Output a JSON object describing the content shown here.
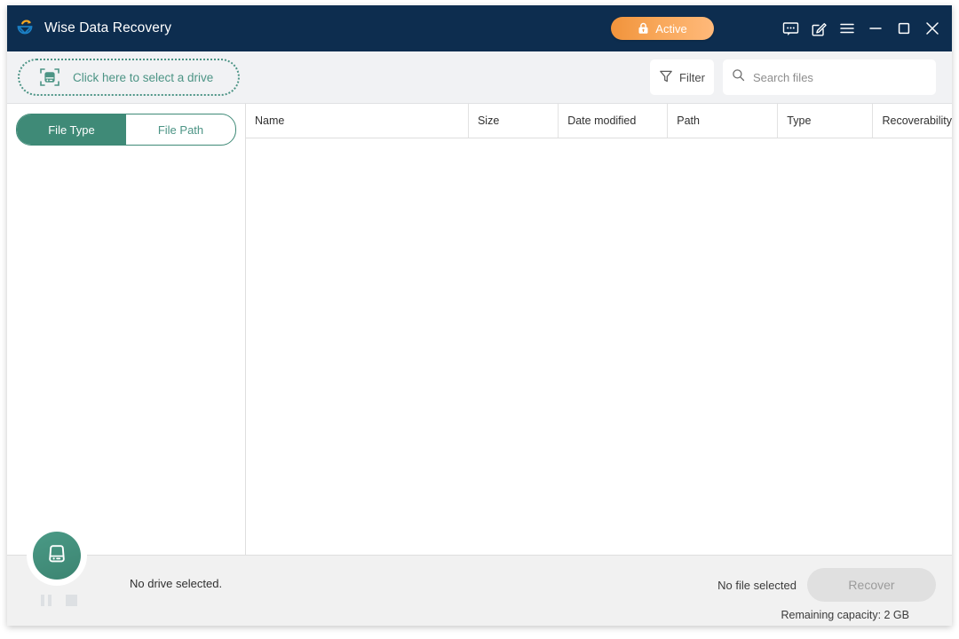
{
  "window": {
    "title": "Wise Data Recovery",
    "logo_icon": "wise-recovery-logo",
    "license_badge": {
      "label": "Active",
      "icon": "lock-icon",
      "color_start": "#f1933b",
      "color_end": "#ffb97a"
    },
    "controls": [
      {
        "name": "feedback",
        "icon": "speech-bubble-icon"
      },
      {
        "name": "edit",
        "icon": "pencil-square-icon"
      },
      {
        "name": "menu",
        "icon": "hamburger-menu-icon"
      },
      {
        "name": "minimize",
        "icon": "minimize-icon"
      },
      {
        "name": "maximize",
        "icon": "maximize-icon"
      },
      {
        "name": "close",
        "icon": "close-icon"
      }
    ],
    "titlebar_color": "#0d2d4f"
  },
  "toolbar": {
    "drive_select": {
      "label": "Click here to select a drive",
      "icon": "drive-scan-icon",
      "accent": "#4c9485"
    },
    "filter": {
      "label": "Filter",
      "icon": "funnel-icon"
    },
    "search": {
      "placeholder": "Search files",
      "value": "",
      "icon": "search-icon"
    }
  },
  "sidebar": {
    "tabs": [
      {
        "label": "File Type",
        "active": true
      },
      {
        "label": "File Path",
        "active": false
      }
    ],
    "accent": "#3f8a77"
  },
  "table": {
    "columns": [
      {
        "label": "Name"
      },
      {
        "label": "Size"
      },
      {
        "label": "Date modified"
      },
      {
        "label": "Path"
      },
      {
        "label": "Type"
      },
      {
        "label": "Recoverability"
      }
    ],
    "rows": []
  },
  "footer": {
    "drive_button_icon": "hard-drive-icon",
    "pause_icon": "pause-icon",
    "stop_icon": "stop-icon",
    "drive_status": "No drive selected.",
    "file_status": "No file selected",
    "recover_label": "Recover",
    "recover_enabled": false,
    "capacity": "Remaining capacity: 2 GB"
  }
}
